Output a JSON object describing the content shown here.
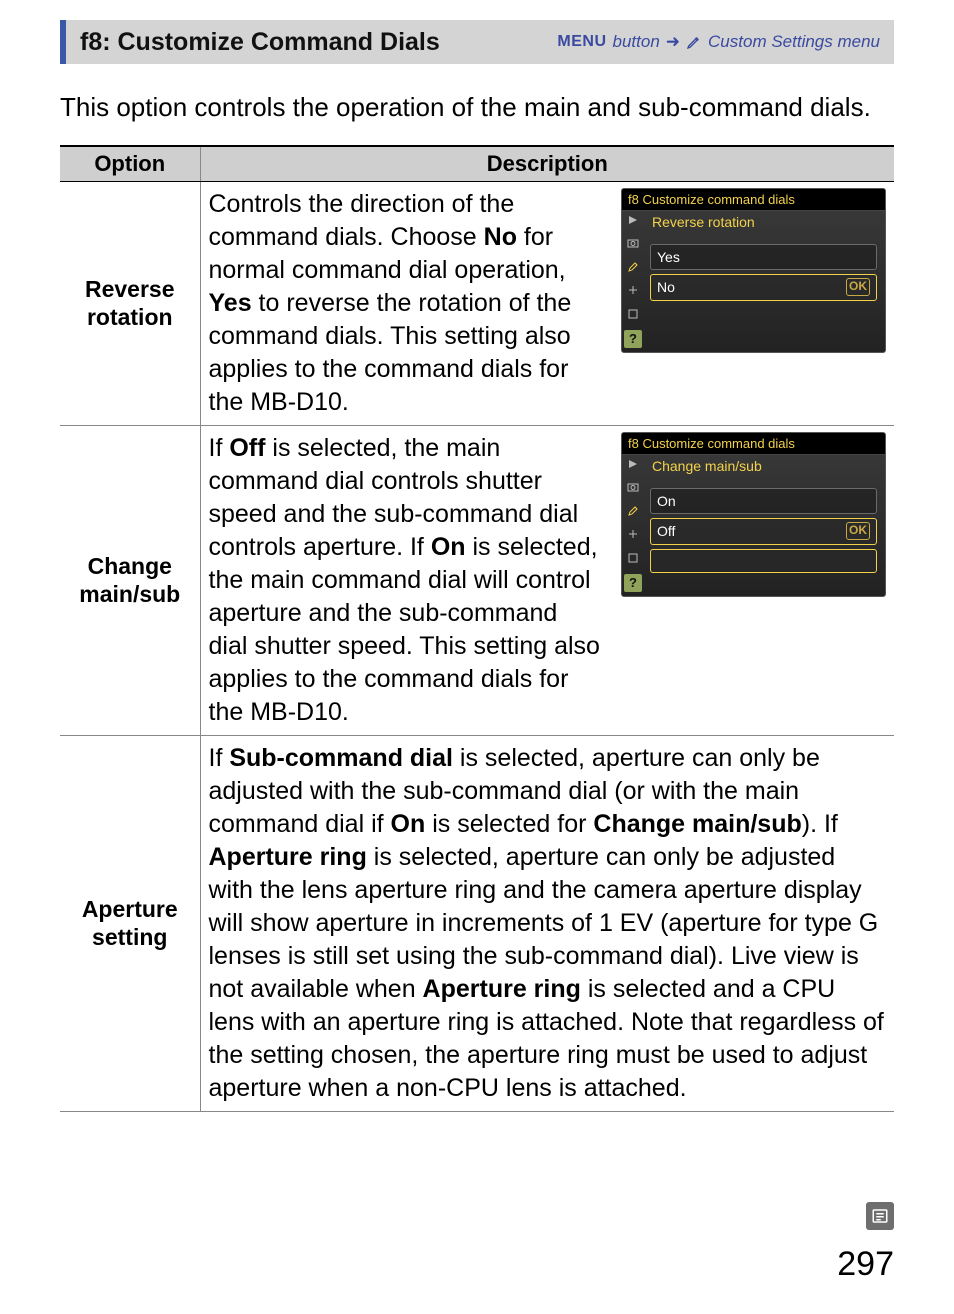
{
  "titlebar": {
    "title": "f8: Customize Command Dials",
    "menu_label": "MENU",
    "button_word": "button",
    "arrow": "➜",
    "menu_name": "Custom Settings menu"
  },
  "intro": "This option controls the operation of the main and sub-command dials.",
  "table": {
    "head_option": "Option",
    "head_desc": "Description",
    "rows": [
      {
        "option_line1": "Reverse",
        "option_line2": "rotation",
        "desc_pre": "Controls the direction of the command dials.  Choose ",
        "desc_bold1": "No",
        "desc_mid1": " for normal command dial operation, ",
        "desc_bold2": "Yes",
        "desc_mid2": " to reverse the rotation of the command dials.  This setting also applies to the command dials for the MB-D10.",
        "shot": {
          "title_prefix": "f8 Customize command dials",
          "sub": "Reverse rotation",
          "opt1": "Yes",
          "opt2": "No",
          "ok": "OK",
          "sel_index": 1
        }
      },
      {
        "option_line1": "Change",
        "option_line2": "main/sub",
        "desc_pre": "If ",
        "desc_bold1": "Off",
        "desc_mid1": " is selected, the main command dial controls shutter speed and the sub-command dial controls aperture.  If ",
        "desc_bold2": "On",
        "desc_mid2": " is selected, the main command dial will control aperture and the sub-command dial shutter speed.  This setting also applies to the command dials for the MB-D10.",
        "shot": {
          "title_prefix": "f8 Customize command dials",
          "sub": "Change main/sub",
          "opt1": "On",
          "opt2": "Off",
          "ok": "OK",
          "sel_index": 1
        }
      },
      {
        "option_line1": "Aperture",
        "option_line2": "setting",
        "long": {
          "p1": "If ",
          "b1": "Sub-command dial",
          "p2": " is selected, aperture can only be adjusted with the sub-command dial (or with the main command dial if ",
          "b2": "On",
          "p3": " is selected for ",
          "b3": "Change main/sub",
          "p4": ").  If ",
          "b4": "Aperture ring",
          "p5": " is selected, aperture can only be adjusted with the lens aperture ring and the camera aperture display will show aperture in increments of 1 EV (aperture for type G lenses is still set using the sub-command dial).  Live view is not available when ",
          "b5": "Aperture ring",
          "p6": " is selected and a CPU lens with an aperture ring is attached.  Note that regardless of the setting chosen, the aperture ring must be used to adjust aperture when a non-CPU lens is attached."
        }
      }
    ]
  },
  "page_number": "297",
  "q": "?"
}
